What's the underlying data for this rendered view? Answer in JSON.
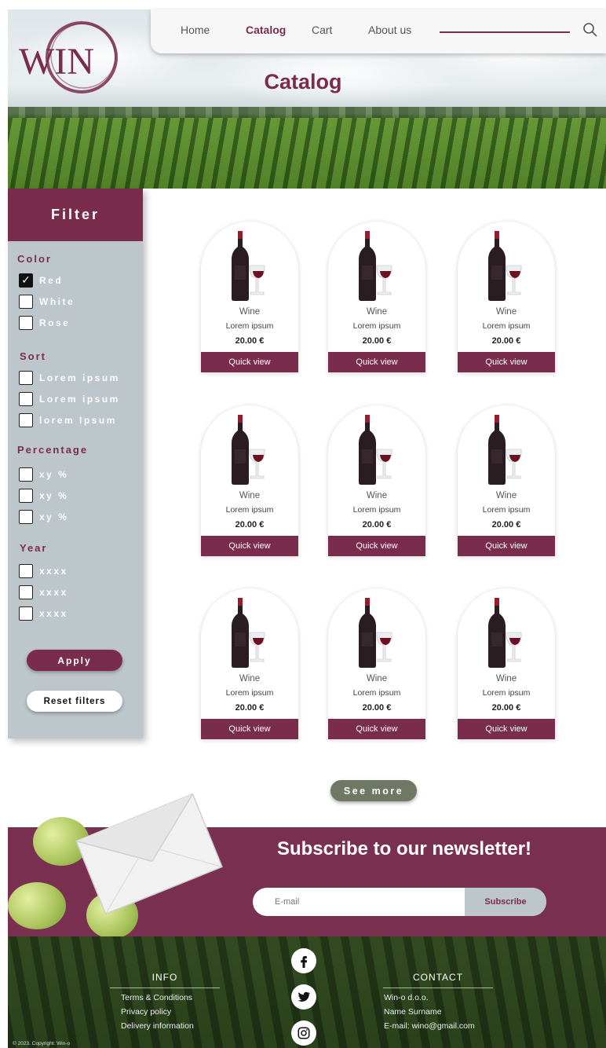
{
  "brand": {
    "logo_text": "WIN",
    "accent_color": "#7a2c4c"
  },
  "nav": {
    "items": [
      {
        "label": "Home"
      },
      {
        "label": "Catalog",
        "active": true
      },
      {
        "label": "Cart"
      },
      {
        "label": "About us"
      }
    ],
    "search_icon": "search-icon"
  },
  "hero": {
    "title": "Catalog"
  },
  "filter": {
    "title": "Filter",
    "groups": [
      {
        "title": "Color",
        "options": [
          {
            "label": "Red",
            "checked": true
          },
          {
            "label": "White",
            "checked": false
          },
          {
            "label": "Rose",
            "checked": false
          }
        ]
      },
      {
        "title": "Sort",
        "options": [
          {
            "label": "Lorem ipsum",
            "checked": false
          },
          {
            "label": "Lorem ipsum",
            "checked": false
          },
          {
            "label": "lorem Ipsum",
            "checked": false
          }
        ]
      },
      {
        "title": "Percentage",
        "options": [
          {
            "label": "xy %",
            "checked": false
          },
          {
            "label": "xy %",
            "checked": false
          },
          {
            "label": "xy %",
            "checked": false
          }
        ]
      },
      {
        "title": "Year",
        "options": [
          {
            "label": "xxxx",
            "checked": false
          },
          {
            "label": "xxxx",
            "checked": false
          },
          {
            "label": "xxxx",
            "checked": false
          }
        ]
      }
    ],
    "apply_label": "Apply",
    "reset_label": "Reset filters"
  },
  "products": [
    {
      "name": "Wine",
      "description": "Lorem ipsum",
      "price": "20.00 €",
      "action": "Quick view"
    },
    {
      "name": "Wine",
      "description": "Lorem ipsum",
      "price": "20.00 €",
      "action": "Quick view"
    },
    {
      "name": "Wine",
      "description": "Lorem ipsum",
      "price": "20.00 €",
      "action": "Quick view"
    },
    {
      "name": "Wine",
      "description": "Lorem ipsum",
      "price": "20.00 €",
      "action": "Quick view"
    },
    {
      "name": "Wine",
      "description": "Lorem ipsum",
      "price": "20.00 €",
      "action": "Quick view"
    },
    {
      "name": "Wine",
      "description": "Lorem ipsum",
      "price": "20.00 €",
      "action": "Quick view"
    },
    {
      "name": "Wine",
      "description": "Lorem ipsum",
      "price": "20.00 €",
      "action": "Quick view"
    },
    {
      "name": "Wine",
      "description": "Lorem ipsum",
      "price": "20.00 €",
      "action": "Quick view"
    },
    {
      "name": "Wine",
      "description": "Lorem ipsum",
      "price": "20.00 €",
      "action": "Quick view"
    }
  ],
  "see_more_label": "See more",
  "newsletter": {
    "title": "Subscribe to our newsletter!",
    "email_placeholder": "E-mail",
    "subscribe_label": "Subscribe"
  },
  "footer": {
    "info": {
      "title": "INFO",
      "links": [
        "Terms & Conditions",
        "Privacy policy",
        "Delivery information"
      ]
    },
    "contact": {
      "title": "CONTACT",
      "lines": [
        "Win-o d.o.o.",
        "Name Surname",
        "E-mail: wino@gmail.com"
      ]
    },
    "social_icons": [
      "facebook-icon",
      "twitter-icon",
      "instagram-icon"
    ],
    "copyright": "© 2023. Copyright: Win-o"
  }
}
